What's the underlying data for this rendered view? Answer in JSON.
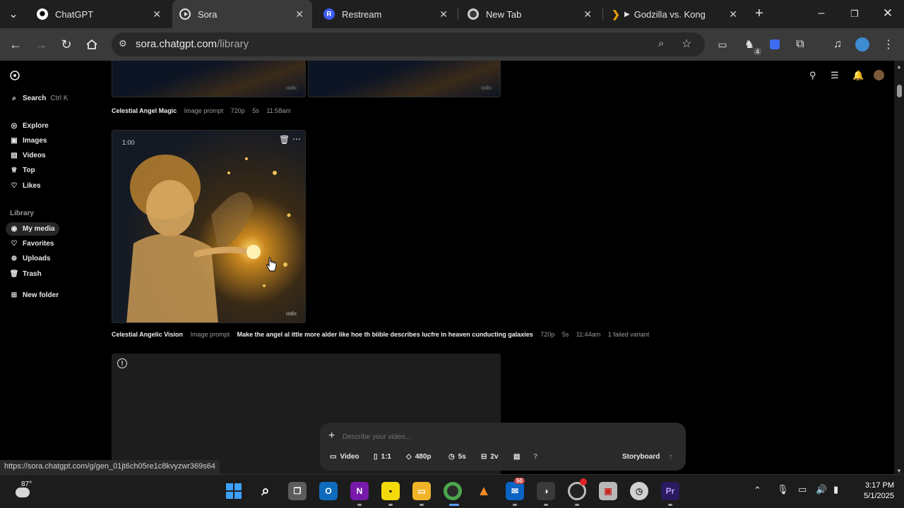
{
  "tabs": [
    {
      "title": "ChatGPT",
      "icon": "chatgpt-icon"
    },
    {
      "title": "Sora",
      "icon": "sora-icon"
    },
    {
      "title": "Restream",
      "icon": "restream-icon"
    },
    {
      "title": "New Tab",
      "icon": "chrome-icon"
    },
    {
      "title": "Godzilla vs. Kong",
      "icon": "plex-icon"
    }
  ],
  "address_bar": {
    "host": "sora.chatgpt.com",
    "path": "/library"
  },
  "extensions_badge": "4",
  "sidebar": {
    "search_label": "Search",
    "search_shortcut": "Ctrl K",
    "nav": [
      {
        "label": "Explore",
        "icon": "explore-icon"
      },
      {
        "label": "Images",
        "icon": "images-icon"
      },
      {
        "label": "Videos",
        "icon": "videos-icon"
      },
      {
        "label": "Top",
        "icon": "trophy-icon"
      },
      {
        "label": "Likes",
        "icon": "heart-icon"
      }
    ],
    "library_heading": "Library",
    "library": [
      {
        "label": "My media",
        "icon": "media-icon"
      },
      {
        "label": "Favorites",
        "icon": "star-icon"
      },
      {
        "label": "Uploads",
        "icon": "upload-icon"
      },
      {
        "label": "Trash",
        "icon": "trash-icon"
      }
    ],
    "new_folder": "New folder"
  },
  "items": [
    {
      "title": "Celestial Angel Magic",
      "kind": "Image prompt",
      "resolution": "720p",
      "duration": "5s",
      "time": "11:58am"
    },
    {
      "title": "Celestial Angelic Vision",
      "kind": "Image prompt",
      "prompt": "Make the angel al ittle more alder like hoe th biible describes lucfre in heaven cunducting galaxies",
      "resolution": "720p",
      "duration": "5s",
      "time": "11:44am",
      "failed": "1 failed variant",
      "card_timestamp": "1:00"
    }
  ],
  "composer": {
    "placeholder": "Describe your video...",
    "mode": "Video",
    "aspect": "1:1",
    "resolution": "480p",
    "duration": "5s",
    "variants": "2v",
    "help": "?",
    "storyboard": "Storyboard"
  },
  "status_url": "https://sora.chatgpt.com/g/gen_01jt6ch05re1c8kvyzwr369s64",
  "taskbar": {
    "weather_temp": "87°",
    "mail_badge": "50",
    "clock_time": "3:17 PM",
    "clock_date": "5/1/2025"
  }
}
